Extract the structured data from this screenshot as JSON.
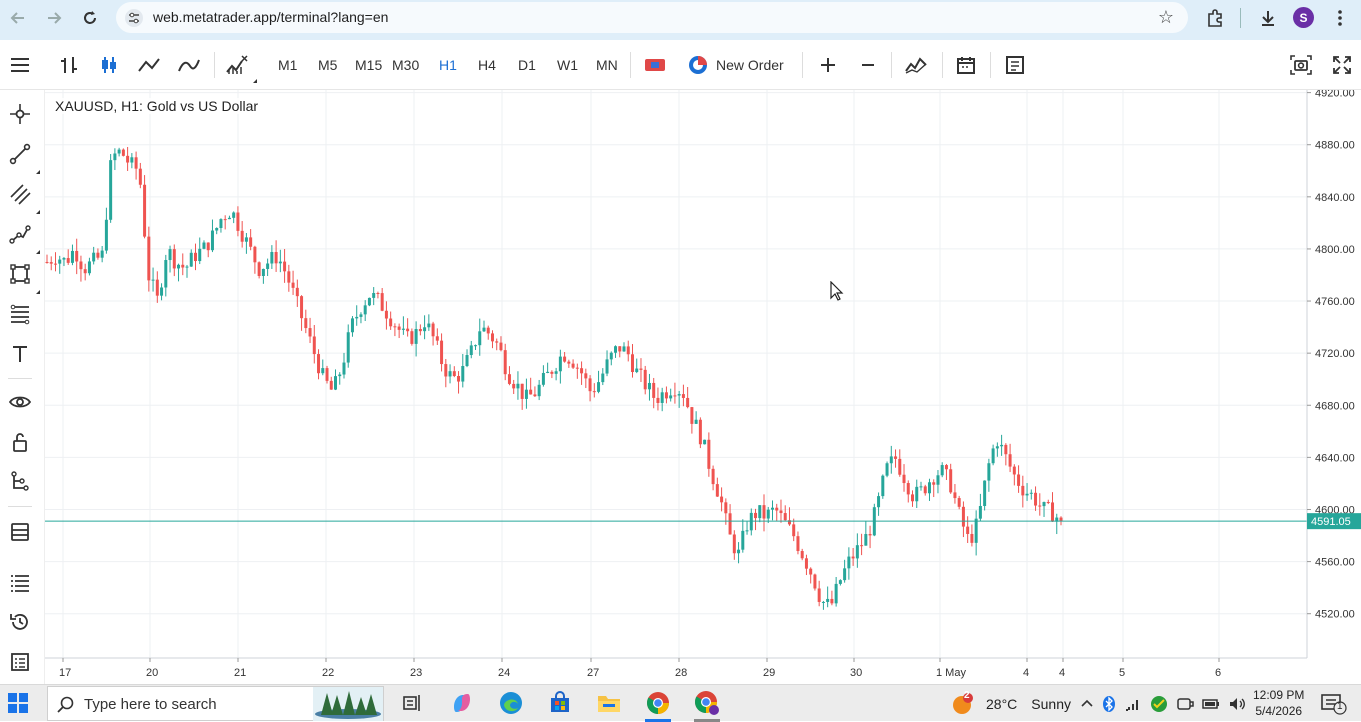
{
  "browser": {
    "url": "web.metatrader.app/terminal?lang=en",
    "profile_initial": "S",
    "icons": [
      "back-arrow-icon",
      "forward-arrow-icon",
      "reload-icon",
      "site-info-icon",
      "star-icon",
      "extensions-icon",
      "download-icon",
      "kebab-menu-icon"
    ]
  },
  "toolbar": {
    "timeframes": [
      "M1",
      "M5",
      "M15",
      "M30",
      "H1",
      "H4",
      "D1",
      "W1",
      "MN"
    ],
    "active_timeframe": "H1",
    "new_order_label": "New Order"
  },
  "chart": {
    "title": "XAUUSD, H1: Gold vs US Dollar",
    "current_price_label": "4591.05",
    "colors": {
      "up": "#26a69a",
      "down": "#ef5350",
      "price_line": "#26a69a",
      "grid": "#eef0f3"
    }
  },
  "chart_data": {
    "type": "candlestick",
    "symbol": "XAUUSD",
    "timeframe": "H1",
    "title": "XAUUSD, H1: Gold vs US Dollar",
    "y_ticks": [
      "4920.00",
      "4880.00",
      "4840.00",
      "4800.00",
      "4760.00",
      "4720.00",
      "4680.00",
      "4640.00",
      "4600.00",
      "4560.00",
      "4520.00"
    ],
    "ylim": [
      4486,
      4922
    ],
    "x_ticks": [
      "17",
      "20",
      "21",
      "22",
      "23",
      "24",
      "27",
      "28",
      "29",
      "30",
      "1 May",
      "4",
      "4",
      "5",
      "6"
    ],
    "current_price": 4591.05,
    "grid": true,
    "series_path": [
      4790,
      4795,
      4790,
      4800,
      4785,
      4790,
      4795,
      4870,
      4875,
      4865,
      4860,
      4780,
      4760,
      4800,
      4790,
      4785,
      4795,
      4800,
      4810,
      4825,
      4830,
      4815,
      4800,
      4785,
      4790,
      4795,
      4780,
      4760,
      4740,
      4720,
      4700,
      4690,
      4710,
      4740,
      4755,
      4765,
      4760,
      4750,
      4740,
      4730,
      4735,
      4745,
      4730,
      4710,
      4700,
      4705,
      4720,
      4740,
      4735,
      4725,
      4705,
      4695,
      4685,
      4690,
      4700,
      4710,
      4720,
      4715,
      4705,
      4690,
      4700,
      4715,
      4725,
      4720,
      4705,
      4695,
      4685,
      4690,
      4695,
      4690,
      4670,
      4655,
      4630,
      4610,
      4580,
      4565,
      4590,
      4598,
      4595,
      4600,
      4590,
      4580,
      4565,
      4550,
      4530,
      4525,
      4545,
      4560,
      4570,
      4580,
      4600,
      4630,
      4640,
      4625,
      4610,
      4615,
      4625,
      4630,
      4620,
      4595,
      4575,
      4590,
      4630,
      4655,
      4640,
      4625,
      4615,
      4610,
      4600,
      4598,
      4591
    ]
  },
  "left_panel": {
    "icons": [
      "crosshair-icon",
      "trend-line-icon",
      "channel-icon",
      "polyline-icon",
      "shapes-icon",
      "fibonacci-icon",
      "text-icon",
      "visibility-eye-icon",
      "lock-icon",
      "object-tree-icon",
      "depth-of-market-icon",
      "list-icon",
      "history-clock-icon",
      "journal-icon"
    ]
  },
  "taskbar": {
    "search_placeholder": "Type here to search",
    "weather_temp": "28°C",
    "weather_desc": "Sunny",
    "weather_badge": "2",
    "time": "12:09 PM",
    "date": "5/4/2026",
    "notification_count": "1"
  }
}
